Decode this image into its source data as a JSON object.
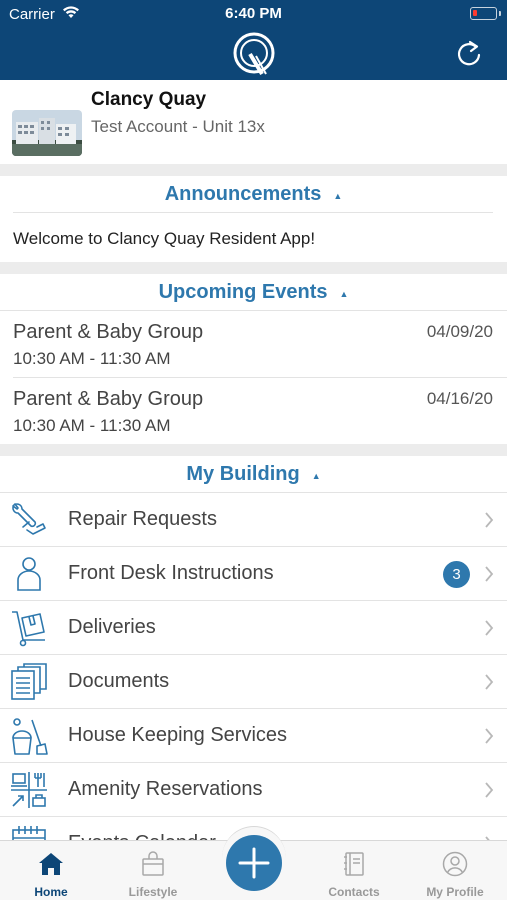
{
  "status_bar": {
    "carrier": "Carrier",
    "time": "6:40 PM"
  },
  "header": {
    "logo_icon": "q-logo-icon",
    "refresh_icon": "refresh-icon",
    "background": "#0d4677"
  },
  "profile": {
    "name": "Clancy Quay",
    "account": "Test Account - Unit 13x"
  },
  "announcements": {
    "title": "Announcements",
    "items": [
      "Welcome to Clancy Quay Resident App!"
    ]
  },
  "upcoming_events": {
    "title": "Upcoming Events",
    "items": [
      {
        "title": "Parent & Baby Group",
        "time": "10:30 AM - 11:30 AM",
        "date": "04/09/20"
      },
      {
        "title": "Parent & Baby Group",
        "time": "10:30 AM - 11:30 AM",
        "date": "04/16/20"
      }
    ]
  },
  "my_building": {
    "title": "My Building",
    "items": [
      {
        "label": "Repair Requests",
        "icon": "wrench-hand-icon"
      },
      {
        "label": "Front Desk Instructions",
        "icon": "person-icon",
        "badge": "3"
      },
      {
        "label": "Deliveries",
        "icon": "dolly-box-icon"
      },
      {
        "label": "Documents",
        "icon": "documents-icon"
      },
      {
        "label": "House Keeping Services",
        "icon": "cleaning-bucket-icon"
      },
      {
        "label": "Amenity Reservations",
        "icon": "amenities-icon"
      },
      {
        "label": "Events Calendar",
        "icon": "calendar-icon"
      }
    ]
  },
  "tab_bar": {
    "tabs": [
      {
        "label": "Home",
        "icon": "home-icon",
        "active": true
      },
      {
        "label": "Lifestyle",
        "icon": "shopping-bag-icon"
      },
      {
        "label": "Contacts",
        "icon": "contacts-book-icon"
      },
      {
        "label": "My Profile",
        "icon": "user-circle-icon"
      }
    ],
    "fab_icon": "plus-icon"
  },
  "colors": {
    "accent": "#2e78ad",
    "brand": "#0d4677",
    "divider": "#ececec"
  }
}
